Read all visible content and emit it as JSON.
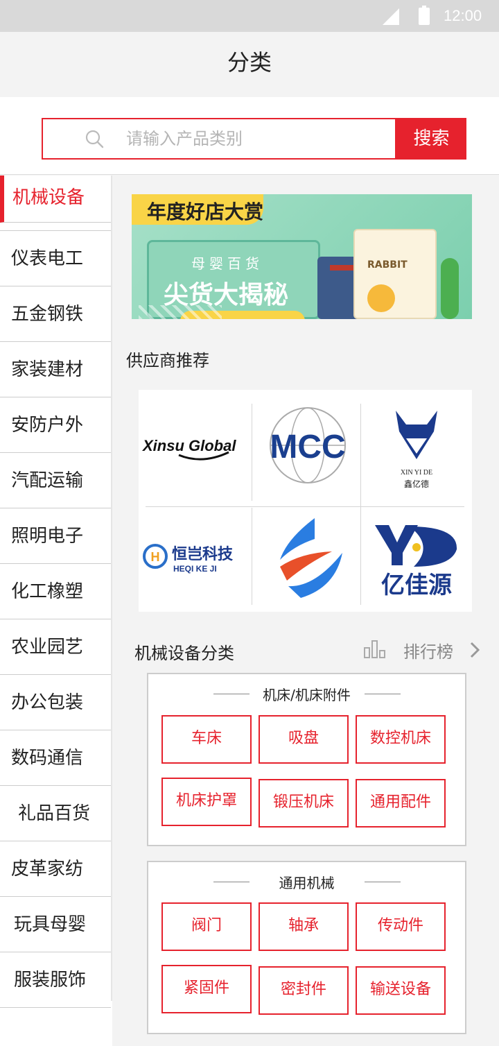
{
  "status_bar": {
    "time": "12:00"
  },
  "header": {
    "title": "分类"
  },
  "search": {
    "placeholder": "请输入产品类别",
    "button_label": "搜索"
  },
  "sidebar": {
    "items": [
      {
        "label": "机械设备",
        "active": true
      },
      {
        "label": "仪表电工"
      },
      {
        "label": "五金钢铁"
      },
      {
        "label": "家装建材"
      },
      {
        "label": "安防户外"
      },
      {
        "label": "汽配运输"
      },
      {
        "label": "照明电子"
      },
      {
        "label": "化工橡塑"
      },
      {
        "label": "农业园艺"
      },
      {
        "label": "办公包装"
      },
      {
        "label": "数码通信"
      },
      {
        "label": "礼品百货"
      },
      {
        "label": "皮革家纺"
      },
      {
        "label": "玩具母婴"
      },
      {
        "label": "服装服饰"
      }
    ]
  },
  "banner": {
    "tag": "年度好店大赏",
    "subtitle": "母婴百货",
    "headline": "尖货大揭秘",
    "product_label": "RABBIT"
  },
  "suppliers": {
    "title": "供应商推荐",
    "logos": [
      {
        "name": "Xinsu Global",
        "icon": "xinsu-global-logo"
      },
      {
        "name": "MCC",
        "icon": "mcc-logo"
      },
      {
        "name": "XIN YI DE",
        "sub": "鑫亿德",
        "icon": "xinyide-logo"
      },
      {
        "name": "恒岂科技",
        "sub": "HEQI KE JI",
        "icon": "heqi-logo"
      },
      {
        "name": "",
        "icon": "swirl-logo"
      },
      {
        "name": "亿佳源",
        "icon": "yijiayuan-logo"
      }
    ]
  },
  "category_section": {
    "title": "机械设备分类",
    "ranking_label": "排行榜",
    "groups": [
      {
        "title": "机床/机床附件",
        "items": [
          "车床",
          "吸盘",
          "数控机床",
          "机床护罩",
          "锻压机床",
          "通用配件"
        ]
      },
      {
        "title": "通用机械",
        "items": [
          "阀门",
          "轴承",
          "传动件",
          "紧固件",
          "密封件",
          "输送设备"
        ]
      }
    ]
  },
  "colors": {
    "accent": "#e6222d",
    "banner_yellow": "#f9d447",
    "banner_mint": "#8fd5b9"
  }
}
